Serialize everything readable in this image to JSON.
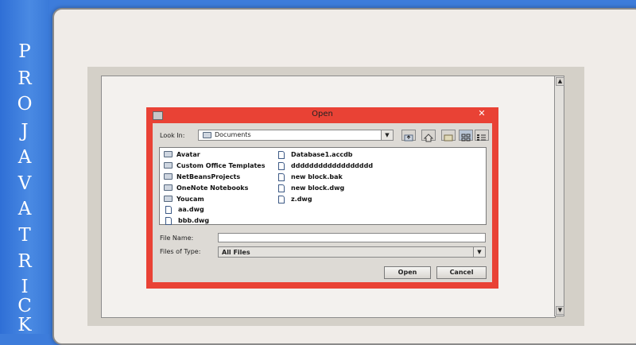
{
  "banner": {
    "letters": [
      "P",
      "R",
      "O",
      "J",
      "A",
      "V",
      "A",
      "T",
      "R",
      "I",
      "C",
      "K"
    ]
  },
  "dialog": {
    "title": "Open",
    "close_glyph": "✕",
    "look_in_label": "Look In:",
    "look_in_value": "Documents",
    "files_left": [
      {
        "name": "Avatar",
        "kind": "folder"
      },
      {
        "name": "Custom Office Templates",
        "kind": "folder"
      },
      {
        "name": "NetBeansProjects",
        "kind": "folder"
      },
      {
        "name": "OneNote Notebooks",
        "kind": "folder"
      },
      {
        "name": "Youcam",
        "kind": "folder"
      },
      {
        "name": "aa.dwg",
        "kind": "file"
      },
      {
        "name": "bbb.dwg",
        "kind": "file"
      }
    ],
    "files_right": [
      {
        "name": "Database1.accdb",
        "kind": "file"
      },
      {
        "name": "dddddddddddddddddd",
        "kind": "file"
      },
      {
        "name": "new block.bak",
        "kind": "file"
      },
      {
        "name": "new block.dwg",
        "kind": "file"
      },
      {
        "name": "z.dwg",
        "kind": "file"
      }
    ],
    "file_name_label": "File Name:",
    "file_name_value": "",
    "files_of_type_label": "Files of Type:",
    "files_of_type_value": "All Files",
    "open_button": "Open",
    "cancel_button": "Cancel"
  },
  "colors": {
    "banner_blue": "#3d7cdb",
    "dialog_red": "#e94235"
  }
}
